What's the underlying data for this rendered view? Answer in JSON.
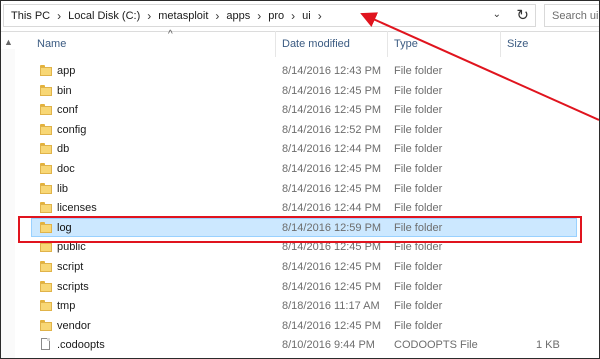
{
  "address_bar": {
    "crumbs": [
      "This PC",
      "Local Disk (C:)",
      "metasploit",
      "apps",
      "pro",
      "ui"
    ],
    "separator": "›",
    "dropdown_glyph": "⌄",
    "refresh_glyph": "↻"
  },
  "search": {
    "placeholder": "Search ui"
  },
  "columns": {
    "name": "Name",
    "date": "Date modified",
    "type": "Type",
    "size": "Size"
  },
  "sort_glyph": "^",
  "files": [
    {
      "name": "app",
      "date": "8/14/2016 12:43 PM",
      "type": "File folder",
      "size": "",
      "icon": "folder-icon"
    },
    {
      "name": "bin",
      "date": "8/14/2016 12:45 PM",
      "type": "File folder",
      "size": "",
      "icon": "folder-icon"
    },
    {
      "name": "conf",
      "date": "8/14/2016 12:45 PM",
      "type": "File folder",
      "size": "",
      "icon": "folder-icon"
    },
    {
      "name": "config",
      "date": "8/14/2016 12:52 PM",
      "type": "File folder",
      "size": "",
      "icon": "folder-icon"
    },
    {
      "name": "db",
      "date": "8/14/2016 12:44 PM",
      "type": "File folder",
      "size": "",
      "icon": "folder-icon"
    },
    {
      "name": "doc",
      "date": "8/14/2016 12:45 PM",
      "type": "File folder",
      "size": "",
      "icon": "folder-icon"
    },
    {
      "name": "lib",
      "date": "8/14/2016 12:45 PM",
      "type": "File folder",
      "size": "",
      "icon": "folder-icon"
    },
    {
      "name": "licenses",
      "date": "8/14/2016 12:44 PM",
      "type": "File folder",
      "size": "",
      "icon": "folder-icon"
    },
    {
      "name": "log",
      "date": "8/14/2016 12:59 PM",
      "type": "File folder",
      "size": "",
      "icon": "folder-icon",
      "selected": true
    },
    {
      "name": "public",
      "date": "8/14/2016 12:45 PM",
      "type": "File folder",
      "size": "",
      "icon": "folder-icon"
    },
    {
      "name": "script",
      "date": "8/14/2016 12:45 PM",
      "type": "File folder",
      "size": "",
      "icon": "folder-icon"
    },
    {
      "name": "scripts",
      "date": "8/14/2016 12:45 PM",
      "type": "File folder",
      "size": "",
      "icon": "folder-icon"
    },
    {
      "name": "tmp",
      "date": "8/18/2016 11:17 AM",
      "type": "File folder",
      "size": "",
      "icon": "folder-icon"
    },
    {
      "name": "vendor",
      "date": "8/14/2016 12:45 PM",
      "type": "File folder",
      "size": "",
      "icon": "folder-icon"
    },
    {
      "name": ".codoopts",
      "date": "8/10/2016 9:44 PM",
      "type": "CODOOPTS File",
      "size": "1 KB",
      "icon": "file-icon"
    }
  ],
  "colors": {
    "highlight": "#e0141e",
    "selection_bg": "#cce8ff",
    "selection_border": "#99d1ff",
    "folder": "#f8d775",
    "header_text": "#3b5b82"
  }
}
